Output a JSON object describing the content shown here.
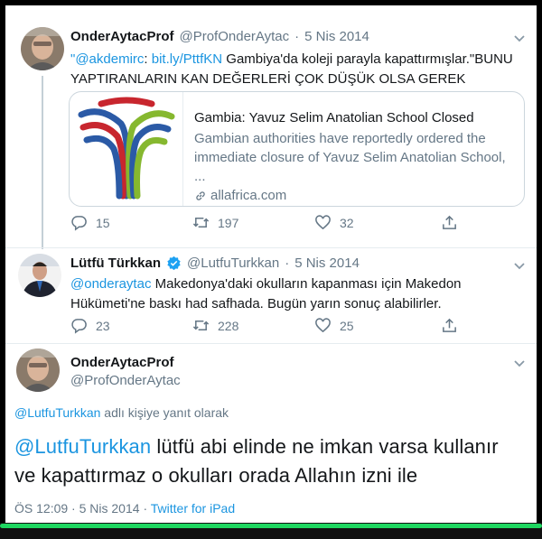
{
  "tweet1": {
    "name": "OnderAytacProf",
    "handle": "@ProfOnderAytac",
    "date": "5 Nis 2014",
    "mention": "\"@akdemirc",
    "text_a": ": ",
    "link": "bit.ly/PttfKN",
    "text_line1": " Gambiya'da koleji parayla kapattırmışlar.\"BUNU",
    "text_line2": "YAPTIRANLARIN KAN DEĞERLERİ ÇOK DÜŞÜK OLSA GEREK",
    "card": {
      "title": "Gambia: Yavuz Selim Anatolian School Closed",
      "desc_line1": "Gambian authorities have reportedly ordered the",
      "desc_line2": "immediate closure of Yavuz Selim Anatolian School, ...",
      "domain": "allafrica.com"
    },
    "replies": "15",
    "retweets": "197",
    "likes": "32"
  },
  "tweet2": {
    "name": "Lütfü Türkkan",
    "handle": "@LutfuTurkkan",
    "date": "5 Nis 2014",
    "mention": "@onderaytac",
    "text_line1": " Makedonya'daki okulların kapanması için Makedon",
    "text_line2": "Hükümeti'ne baskı had safhada. Bugün yarın sonuç alabilirler.",
    "replies": "23",
    "retweets": "228",
    "likes": "25"
  },
  "tweet3": {
    "name": "OnderAytacProf",
    "handle": "@ProfOnderAytac",
    "reply_mention": "@LutfuTurkkan",
    "reply_suffix": " adlı kişiye yanıt olarak",
    "mention": "@LutfuTurkkan",
    "text_line1": " lütfü abi elinde ne imkan varsa kullanır",
    "text_line2": "ve kapattırmaz o okulları orada Allahın izni ile",
    "time": "ÖS 12:09",
    "meta_date": "5 Nis 2014",
    "source": "Twitter for iPad"
  },
  "colors": {
    "link": "#1b95e0",
    "text": "#14171a",
    "muted": "#657786",
    "verified": "#1da1f2",
    "progress": "#1ed760"
  },
  "icons": [
    "reply-icon",
    "retweet-icon",
    "like-icon",
    "share-icon",
    "chevron-down-icon",
    "verified-icon",
    "link-icon"
  ],
  "progress": 1.0
}
